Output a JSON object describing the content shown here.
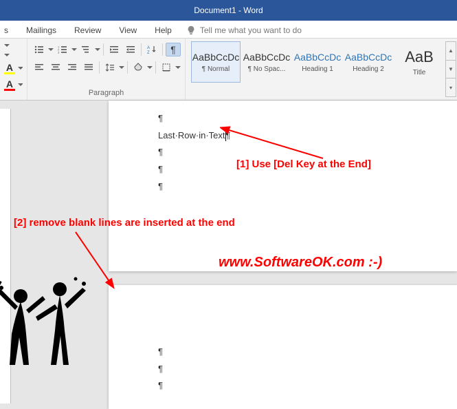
{
  "titlebar": {
    "text": "Document1  -  Word"
  },
  "tabs": {
    "partial": "s",
    "mailings": "Mailings",
    "review": "Review",
    "view": "View",
    "help": "Help"
  },
  "search": {
    "placeholder": "Tell me what you want to do"
  },
  "groups": {
    "paragraph": "Paragraph"
  },
  "font": {
    "underline_A": "A",
    "highlight_A": "A"
  },
  "styles": {
    "preview": "AaBbCcDc",
    "preview_title": "AaB",
    "normal": "¶ Normal",
    "nospace": "¶ No Spac...",
    "h1": "Heading 1",
    "h2": "Heading 2",
    "title": "Title"
  },
  "doc": {
    "pilcrow": "¶",
    "line": "Last·Row·in·Text"
  },
  "annotations": {
    "a1": "[1] Use [Del Key at the End]",
    "a2": "[2] remove blank lines are inserted at the end",
    "url": "www.SoftwareOK.com :-)"
  }
}
